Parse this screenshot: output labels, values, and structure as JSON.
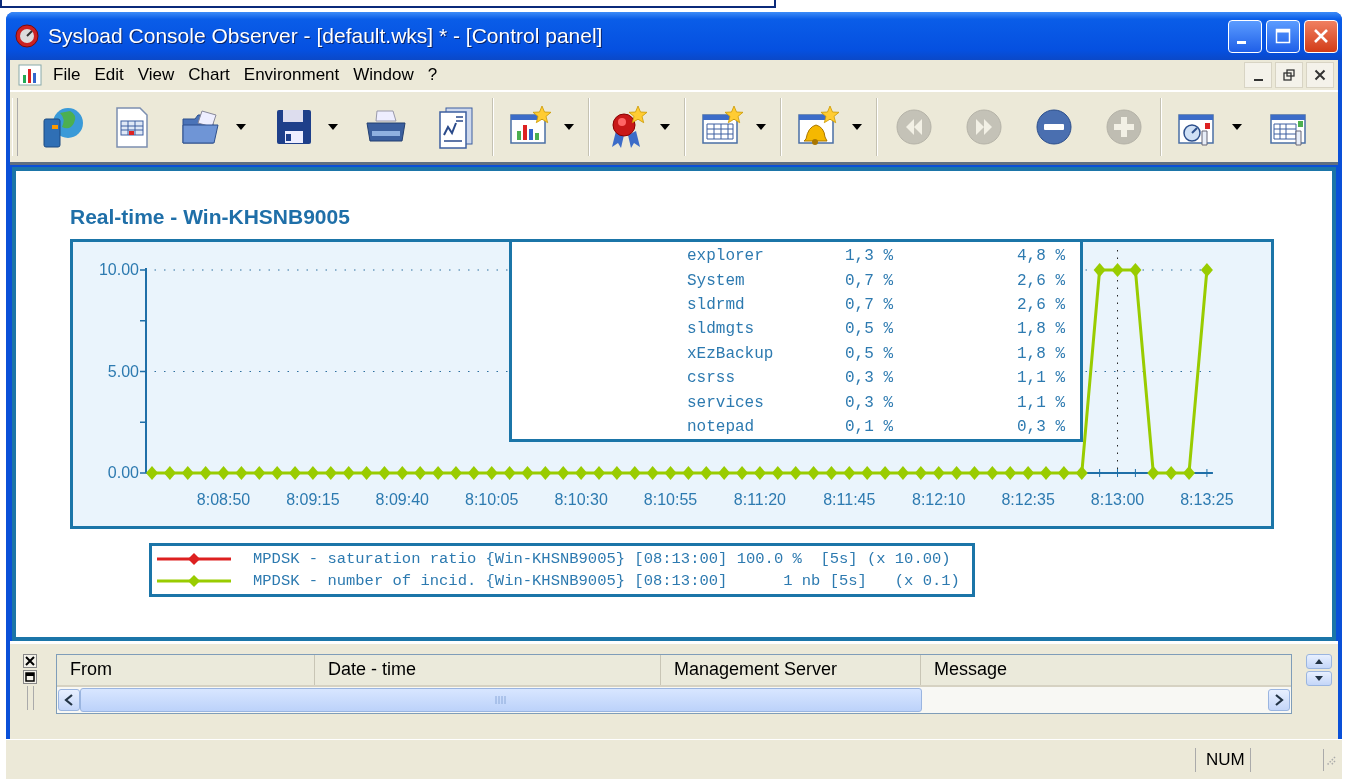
{
  "window": {
    "title": "Sysload Console Observer - [default.wks] * - [Control panel]"
  },
  "menu": [
    {
      "label": "File"
    },
    {
      "label": "Edit"
    },
    {
      "label": "View"
    },
    {
      "label": "Chart"
    },
    {
      "label": "Environment"
    },
    {
      "label": "Window"
    },
    {
      "label": "?"
    }
  ],
  "toolbar": {
    "groups": [
      {
        "items": [
          {
            "disabled": false,
            "dropdown": false
          },
          {
            "disabled": false,
            "dropdown": false
          },
          {
            "disabled": false,
            "dropdown": true
          },
          {
            "disabled": false,
            "dropdown": true
          },
          {
            "disabled": false,
            "dropdown": false
          },
          {
            "disabled": false,
            "dropdown": false
          }
        ]
      },
      {
        "items": [
          {
            "disabled": false,
            "dropdown": true
          }
        ]
      },
      {
        "items": [
          {
            "disabled": false,
            "dropdown": true
          }
        ]
      },
      {
        "items": [
          {
            "disabled": false,
            "dropdown": true
          }
        ]
      },
      {
        "items": [
          {
            "disabled": false,
            "dropdown": true
          }
        ]
      },
      {
        "items": [
          {
            "disabled": true,
            "dropdown": false
          },
          {
            "disabled": true,
            "dropdown": false
          },
          {
            "disabled": false,
            "dropdown": false
          },
          {
            "disabled": true,
            "dropdown": false
          }
        ]
      },
      {
        "items": [
          {
            "disabled": false,
            "dropdown": true
          },
          {
            "disabled": false,
            "dropdown": false
          }
        ]
      }
    ]
  },
  "chart_panel": {
    "title": "Real-time - Win-KHSNB9005",
    "chart_data": {
      "type": "line",
      "ylim": [
        0,
        10
      ],
      "ref_lines": [
        {
          "axis": "y",
          "value": 5
        },
        {
          "axis": "y",
          "value": 10
        }
      ],
      "categories": [
        null,
        null,
        null,
        null,
        "8:08:50",
        null,
        null,
        null,
        null,
        "8:09:15",
        null,
        null,
        null,
        null,
        "8:09:40",
        null,
        null,
        null,
        null,
        "8:10:05",
        null,
        null,
        null,
        null,
        "8:10:30",
        null,
        null,
        null,
        null,
        "8:10:55",
        null,
        null,
        null,
        null,
        "8:11:20",
        null,
        null,
        null,
        null,
        "8:11:45",
        null,
        null,
        null,
        null,
        "8:12:10",
        null,
        null,
        null,
        null,
        "8:12:35",
        null,
        null,
        null,
        null,
        "8:13:00",
        null,
        null,
        null,
        null,
        "8:13:25"
      ],
      "yticks": [
        {
          "value": 0,
          "label": "0.00"
        },
        {
          "value": 5,
          "label": "5.00"
        },
        {
          "value": 10,
          "label": "10.00"
        }
      ],
      "series": [
        {
          "color": "#99cc00",
          "marker": "diamond",
          "values": [
            0,
            0,
            0,
            0,
            0,
            0,
            0,
            0,
            0,
            0,
            0,
            0,
            0,
            0,
            0,
            0,
            0,
            0,
            0,
            0,
            0,
            0,
            0,
            0,
            0,
            0,
            0,
            0,
            0,
            0,
            0,
            0,
            0,
            0,
            0,
            0,
            0,
            0,
            0,
            0,
            0,
            0,
            0,
            0,
            0,
            0,
            0,
            0,
            0,
            0,
            0,
            0,
            0,
            10,
            10,
            10,
            0,
            0,
            0,
            10
          ]
        }
      ]
    },
    "processes": [
      {
        "name": "explorer",
        "column_2": "1,3 %",
        "column_3": "4,8 %"
      },
      {
        "name": "System",
        "column_2": "0,7 %",
        "column_3": "2,6 %"
      },
      {
        "name": "sldrmd",
        "column_2": "0,7 %",
        "column_3": "2,6 %"
      },
      {
        "name": "sldmgts",
        "column_2": "0,5 %",
        "column_3": "1,8 %"
      },
      {
        "name": "xEzBackup",
        "column_2": "0,5 %",
        "column_3": "1,8 %"
      },
      {
        "name": "csrss",
        "column_2": "0,3 %",
        "column_3": "1,1 %"
      },
      {
        "name": "services",
        "column_2": "0,3 %",
        "column_3": "1,1 %"
      },
      {
        "name": "notepad",
        "column_2": "0,1 %",
        "column_3": "0,3 %"
      }
    ],
    "legend": [
      {
        "color": "#dd2020",
        "text": "MPDSK - saturation ratio {Win-KHSNB9005} [08:13:00] 100.0 %  [5s] (x 10.00)"
      },
      {
        "color": "#99cc00",
        "text": "MPDSK - number of incid. {Win-KHSNB9005} [08:13:00]      1 nb [5s]   (x 0.1)"
      }
    ]
  },
  "message_list": {
    "columns": [
      "From",
      "Date - time",
      "Management Server",
      "Message"
    ]
  },
  "status_bar": {
    "panels": [
      "NUM"
    ]
  }
}
